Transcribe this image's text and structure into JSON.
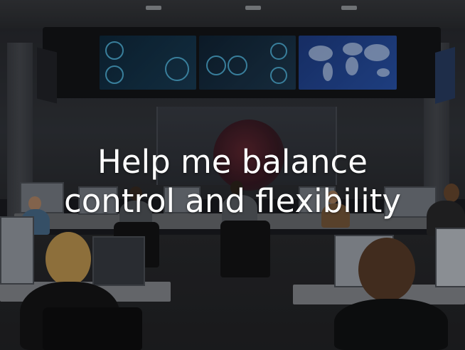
{
  "hero": {
    "headline_line1": "Help me balance",
    "headline_line2": "control and flexibility",
    "text_color": "#ffffff",
    "background_image": "operations-center-photo"
  }
}
